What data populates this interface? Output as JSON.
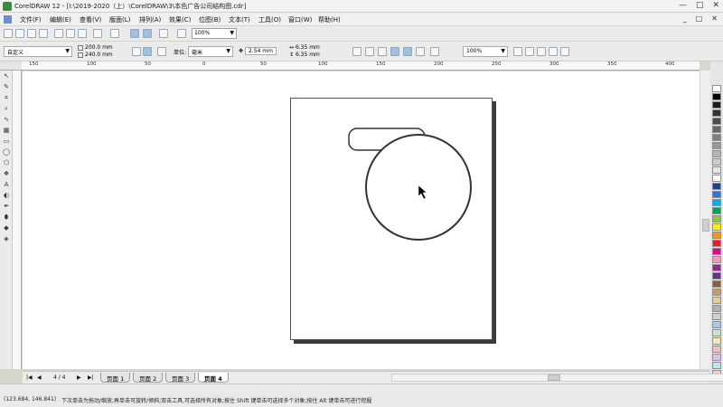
{
  "window": {
    "title": "CorelDRAW 12 - [I:\\2019-2020（上）\\CorelDRAW\\3\\本色广告公司结构图.cdr]",
    "controls": [
      "—",
      "□",
      "✕"
    ]
  },
  "menu": {
    "items": [
      "文件(F)",
      "编辑(E)",
      "查看(V)",
      "版面(L)",
      "排列(A)",
      "效果(C)",
      "位图(B)",
      "文本(T)",
      "工具(O)",
      "窗口(W)",
      "帮助(H)"
    ],
    "doc_controls": [
      "_",
      "□",
      "✕"
    ]
  },
  "toolbar": {
    "zoom_value": "100%"
  },
  "property_bar": {
    "paper_preset": "自定义",
    "width": "200.0 mm",
    "height": "240.0 mm",
    "units_label": "单位:",
    "units_value": "毫米",
    "nudge": "2.54 mm",
    "dup_x": "6.35 mm",
    "dup_y": "6.35 mm",
    "zoom_value": "100%"
  },
  "ruler": {
    "labels": [
      "150",
      "100",
      "50",
      "0",
      "50",
      "100",
      "150",
      "200",
      "250",
      "300",
      "350",
      "400"
    ]
  },
  "page_nav": {
    "position": "4 / 4",
    "tabs": [
      "页面 1",
      "页面 2",
      "页面 3",
      "页面 4"
    ],
    "active_tab": 3
  },
  "status": {
    "coords": "(123.684, 146.841)",
    "message": "下次单击为拖动/缩放;再单击可旋转/倾斜;双击工具,可选择所有对象;按住 Shift 键单击可选择多个对象;按住 Alt 键单击可进行挖掘"
  },
  "palette": {
    "colors": [
      "#ffffff",
      "#000000",
      "#1a1a1a",
      "#333333",
      "#4d4d4d",
      "#666666",
      "#808080",
      "#999999",
      "#b3b3b3",
      "#cccccc",
      "#e6e6e6",
      "#ffffff",
      "#1f3f9e",
      "#2d74d6",
      "#00aeef",
      "#00a650",
      "#8dc63f",
      "#fff200",
      "#f7941d",
      "#ed1c24",
      "#ec008c",
      "#f49ac1",
      "#92278f",
      "#662d91",
      "#8b5e3c",
      "#c69c6d",
      "#e8cba0",
      "#b0b0b0",
      "#d0d0d0",
      "#a8c8e8",
      "#c8e8c8",
      "#f8e8b0",
      "#f0c0c0",
      "#d8c0e8",
      "#bfe3ef",
      "#e5d5c0"
    ]
  }
}
